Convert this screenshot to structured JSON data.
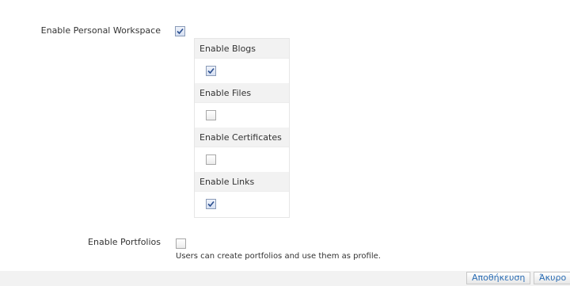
{
  "settings": {
    "personal_workspace_label": "Enable Personal Workspace",
    "personal_workspace_checked": true,
    "sub_options": [
      {
        "label": "Enable Blogs",
        "checked": true
      },
      {
        "label": "Enable Files",
        "checked": false
      },
      {
        "label": "Enable Certificates",
        "checked": false
      },
      {
        "label": "Enable Links",
        "checked": true
      }
    ],
    "portfolios_label": "Enable Portfolios",
    "portfolios_checked": false,
    "portfolios_help": "Users can create portfolios and use them as profile."
  },
  "footer": {
    "save_label": "Αποθήκευση",
    "cancel_label": "Άκυρο"
  },
  "colors": {
    "accent_text": "#2a6cb3",
    "check_mark": "#2b4f8f"
  }
}
